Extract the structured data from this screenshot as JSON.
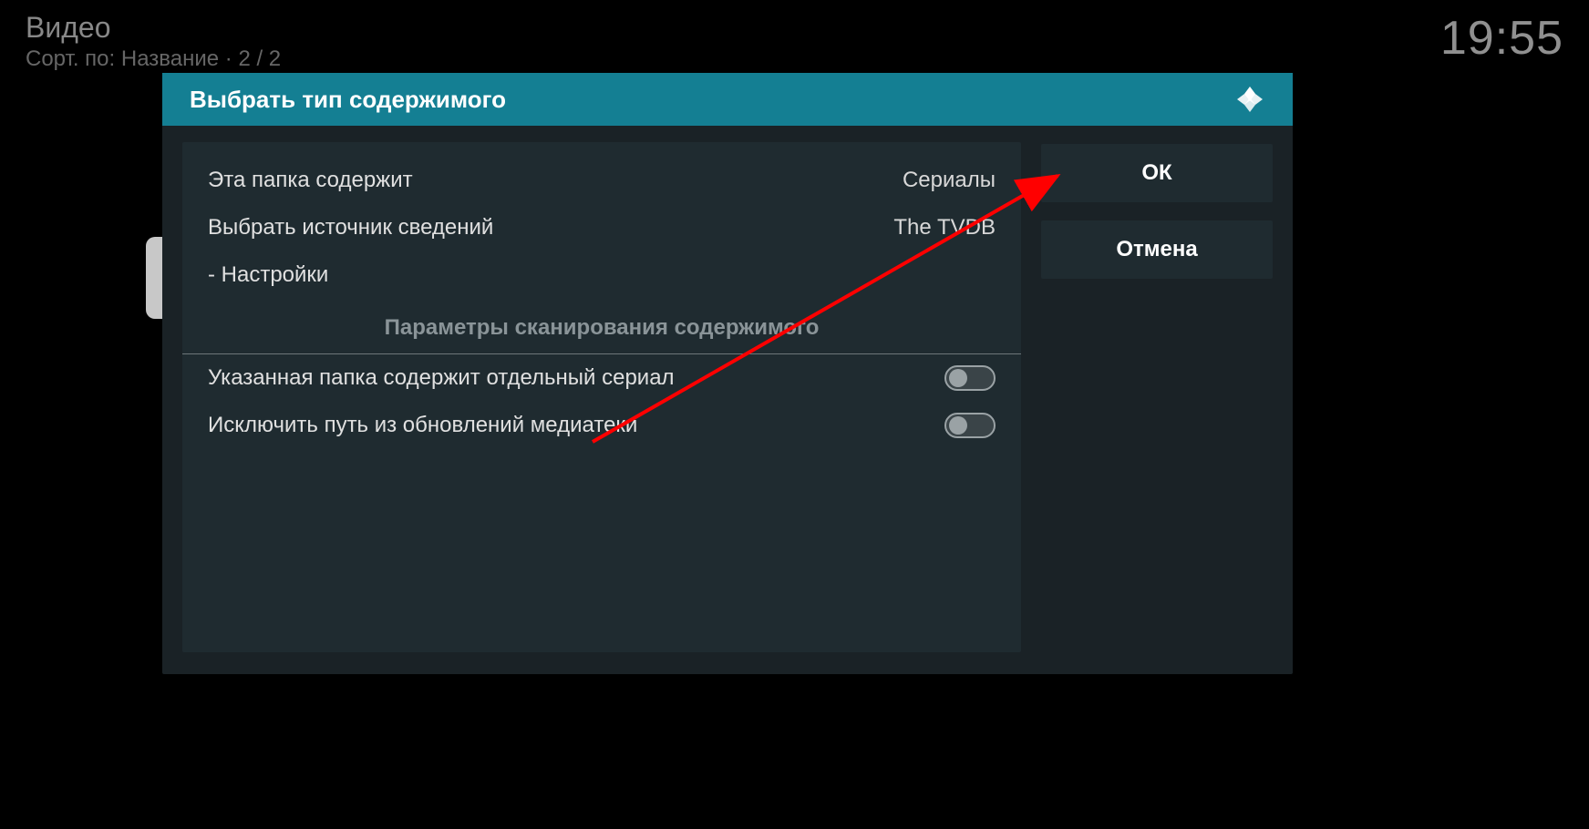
{
  "background": {
    "title": "Видео",
    "sort_prefix": "Сорт. по: ",
    "sort_value": "Название",
    "page_info": "2 / 2",
    "clock": "19:55"
  },
  "dialog": {
    "title": "Выбрать тип содержимого",
    "settings": {
      "folder_contains": {
        "label": "Эта папка содержит",
        "value": "Сериалы"
      },
      "info_source": {
        "label": "Выбрать источник сведений",
        "value": "The TVDB"
      },
      "sub_settings": {
        "label": "- Настройки"
      }
    },
    "section_header": "Параметры сканирования содержимого",
    "toggles": {
      "single_series": {
        "label": "Указанная папка содержит отдельный сериал",
        "enabled": false
      },
      "exclude_path": {
        "label": "Исключить путь из обновлений медиатеки",
        "enabled": false
      }
    },
    "buttons": {
      "ok": "ОК",
      "cancel": "Отмена"
    }
  }
}
